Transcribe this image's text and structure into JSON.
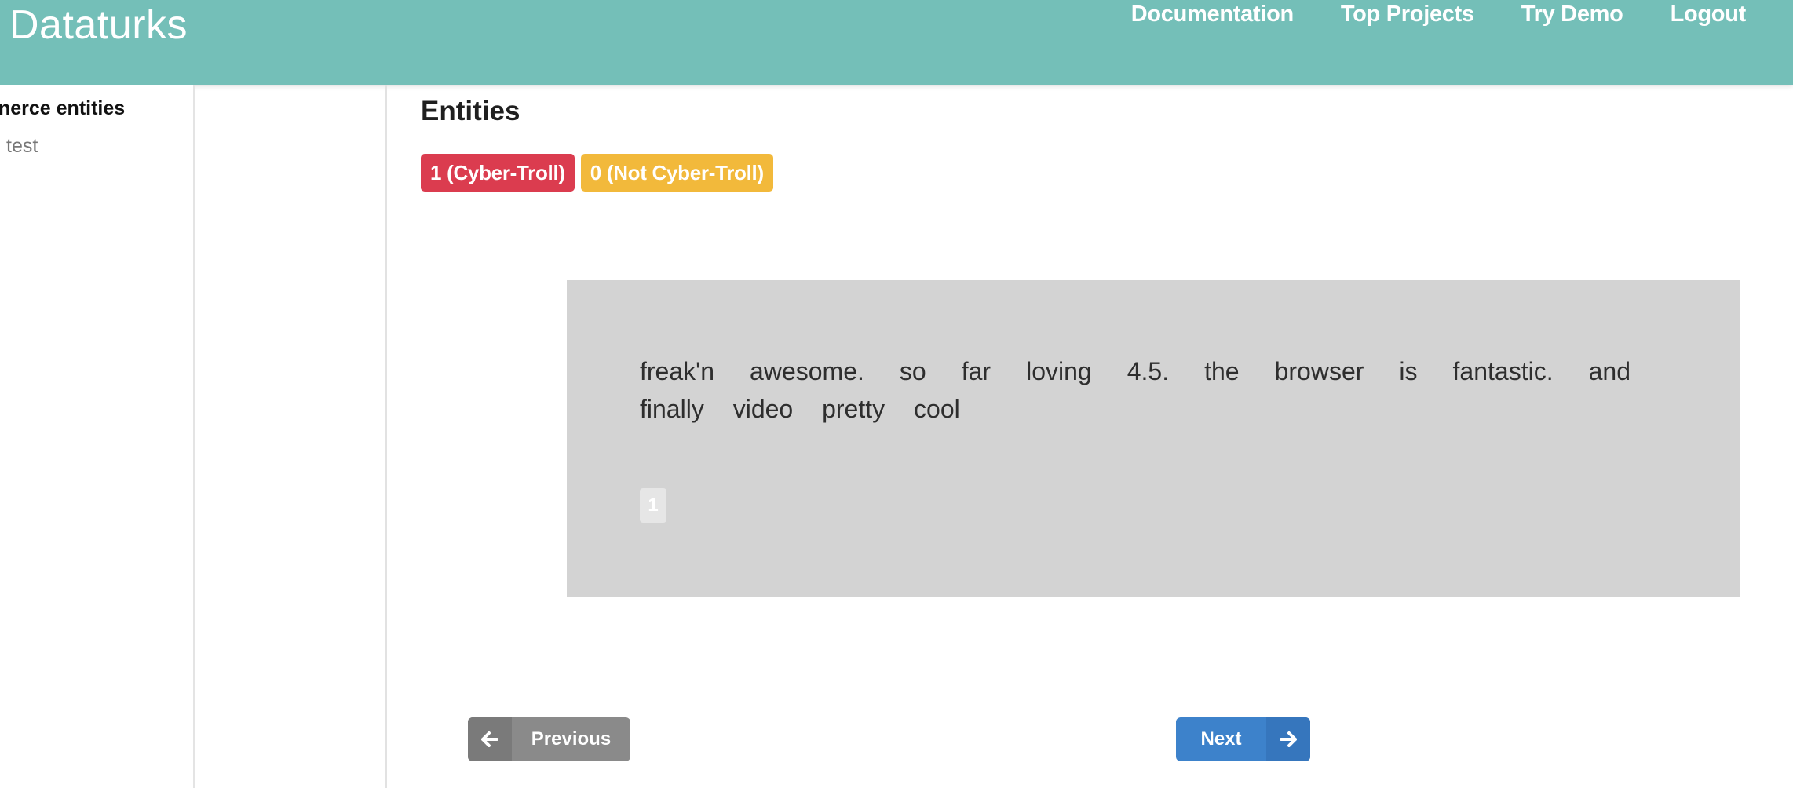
{
  "header": {
    "brand": "Dataturks",
    "nav": [
      "Documentation",
      "Top Projects",
      "Try Demo",
      "Logout"
    ]
  },
  "sidebar": {
    "title": "nerce entities",
    "subtitle": "test"
  },
  "main": {
    "entities_title": "Entities",
    "labels": [
      {
        "text": "1 (Cyber-Troll)",
        "color": "#db3c4f"
      },
      {
        "text": "0 (Not Cyber-Troll)",
        "color": "#f2b93b"
      }
    ],
    "document_text": "freak'n awesome. so far loving 4.5. the browser is fantastic. and finally video pretty cool",
    "page_number": "1"
  },
  "buttons": {
    "previous": "Previous",
    "next": "Next"
  },
  "icons": {
    "previous": "arrow-left-icon",
    "next": "arrow-right-icon"
  }
}
